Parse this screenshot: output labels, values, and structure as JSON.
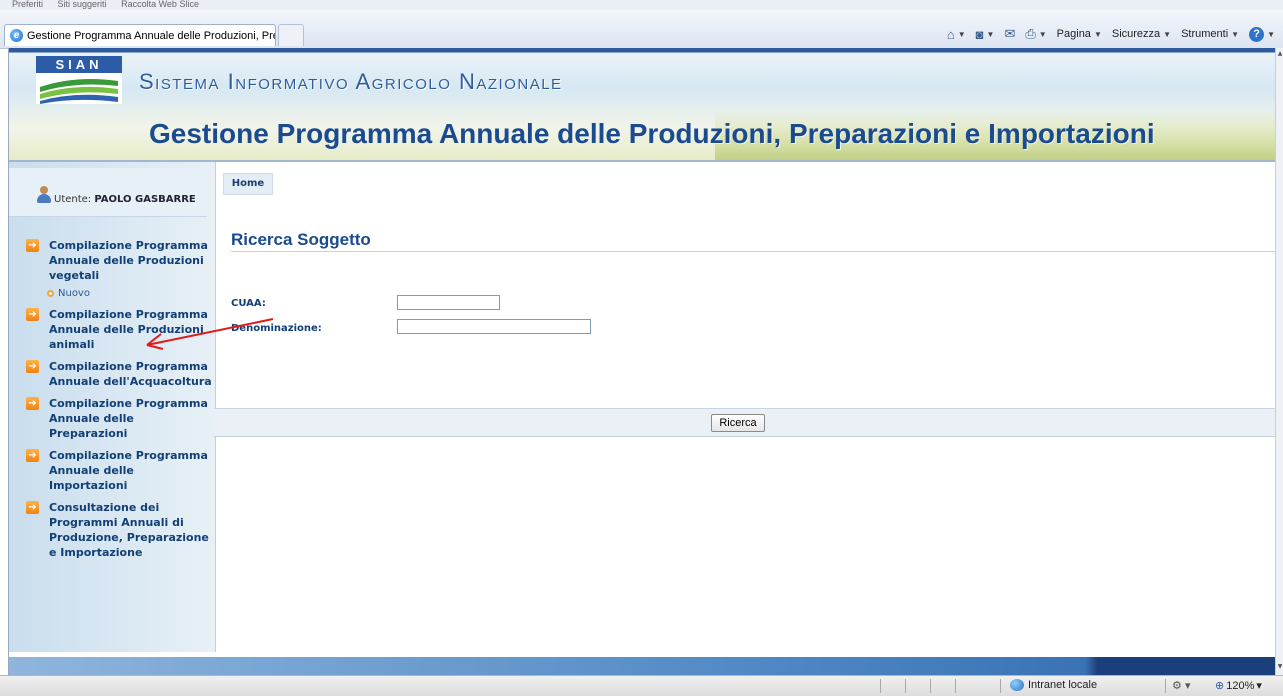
{
  "browser": {
    "favorites_items": [
      "Preferiti",
      "Siti suggeriti",
      "Raccolta Web Slice"
    ],
    "tab_title": "Gestione Programma Annuale delle Produzioni, Prepar...",
    "commands": {
      "page": "Pagina",
      "security": "Sicurezza",
      "tools": "Strumenti"
    },
    "status": {
      "zone": "Intranet locale",
      "zoom": "120%"
    }
  },
  "header": {
    "logo": "SIAN",
    "system_name": "Sistema Informativo Agricolo Nazionale",
    "app_title": "Gestione Programma Annuale delle Produzioni, Preparazioni e Importazioni"
  },
  "user": {
    "label": "Utente:",
    "name": "PAOLO GASBARRE"
  },
  "menu": {
    "items": [
      {
        "label": "Compilazione Programma Annuale delle Produzioni vegetali",
        "sub": "Nuovo"
      },
      {
        "label": "Compilazione Programma Annuale delle Produzioni animali"
      },
      {
        "label": "Compilazione Programma Annuale dell'Acquacoltura"
      },
      {
        "label": "Compilazione Programma Annuale delle Preparazioni"
      },
      {
        "label": "Compilazione Programma Annuale delle Importazioni"
      },
      {
        "label": "Consultazione dei Programmi Annuali di Produzione, Preparazione e Importazione"
      }
    ]
  },
  "breadcrumb": {
    "home": "Home"
  },
  "form": {
    "title": "Ricerca Soggetto",
    "cuaa_label": "CUAA:",
    "cuaa_value": "",
    "denominazione_label": "Denominazione:",
    "denominazione_value": "",
    "search_label": "Ricerca"
  },
  "colors": {
    "brand_blue": "#1b4b8f",
    "menu_icon_orange": "#f0820f",
    "annotation_red": "#e01b1b"
  }
}
